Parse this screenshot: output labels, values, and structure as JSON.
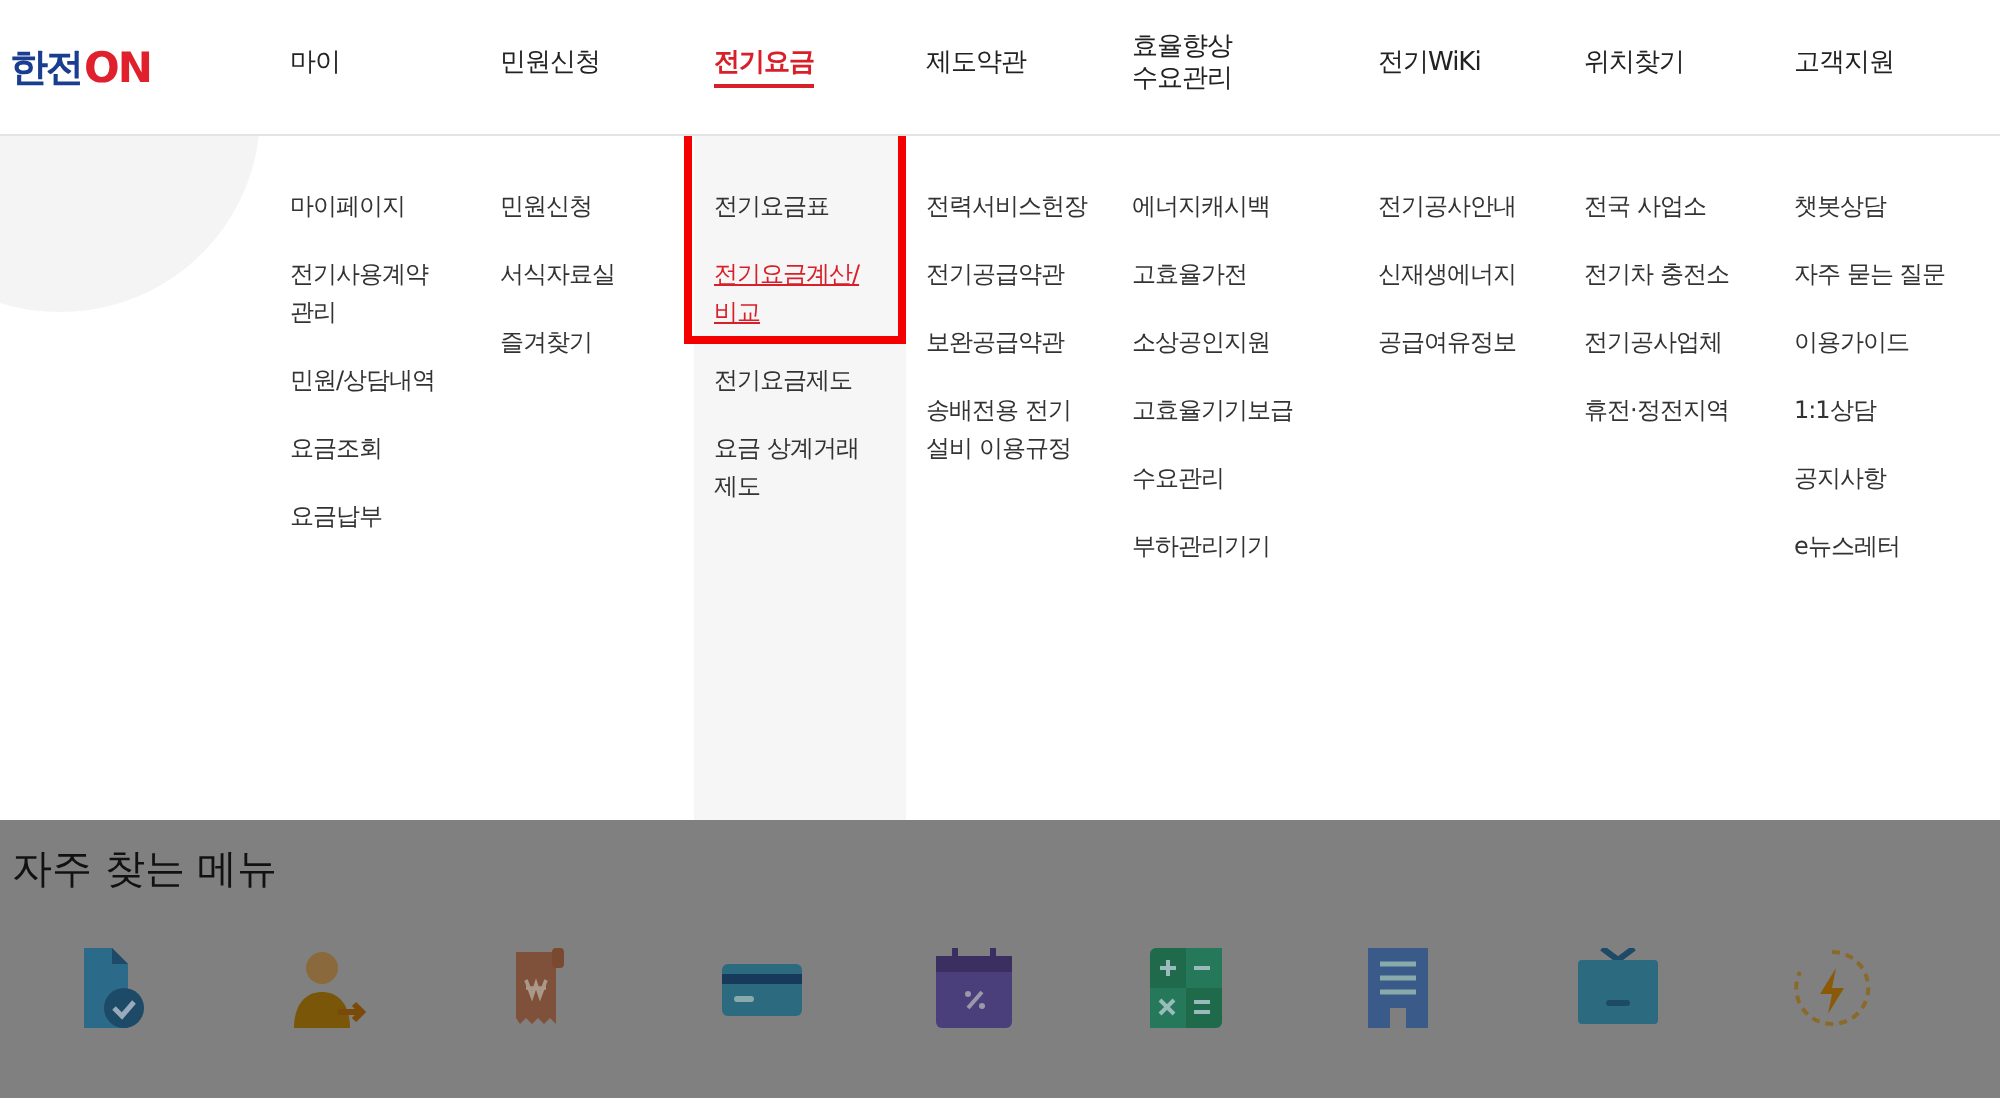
{
  "logo": {
    "text": "한전",
    "mark": "ON"
  },
  "nav": [
    {
      "label": "마이",
      "selected": false,
      "highlighted": false,
      "items": [
        {
          "label": "마이페이지",
          "selected": false
        },
        {
          "label": "전기사용계약 관리",
          "selected": false
        },
        {
          "label": "민원/상담내역",
          "selected": false
        },
        {
          "label": "요금조회",
          "selected": false
        },
        {
          "label": "요금납부",
          "selected": false
        }
      ]
    },
    {
      "label": "민원신청",
      "selected": false,
      "highlighted": false,
      "items": [
        {
          "label": "민원신청",
          "selected": false
        },
        {
          "label": "서식자료실",
          "selected": false
        },
        {
          "label": "즐겨찾기",
          "selected": false
        }
      ]
    },
    {
      "label": "전기요금",
      "selected": true,
      "highlighted": true,
      "items": [
        {
          "label": "전기요금표",
          "selected": false
        },
        {
          "label": "전기요금계산/ 비교",
          "selected": true
        },
        {
          "label": "전기요금제도",
          "selected": false
        },
        {
          "label": "요금 상계거래 제도",
          "selected": false
        }
      ]
    },
    {
      "label": "제도약관",
      "selected": false,
      "highlighted": false,
      "items": [
        {
          "label": "전력서비스헌장",
          "selected": false
        },
        {
          "label": "전기공급약관",
          "selected": false
        },
        {
          "label": "보완공급약관",
          "selected": false
        },
        {
          "label": "송배전용 전기 설비 이용규정",
          "selected": false
        }
      ]
    },
    {
      "label": "효율향상 수요관리",
      "selected": false,
      "highlighted": false,
      "items": [
        {
          "label": "에너지캐시백",
          "selected": false
        },
        {
          "label": "고효율가전",
          "selected": false
        },
        {
          "label": "소상공인지원",
          "selected": false
        },
        {
          "label": "고효율기기보급",
          "selected": false
        },
        {
          "label": "수요관리",
          "selected": false
        },
        {
          "label": "부하관리기기",
          "selected": false
        }
      ]
    },
    {
      "label": "전기WiKi",
      "selected": false,
      "highlighted": false,
      "items": [
        {
          "label": "전기공사안내",
          "selected": false
        },
        {
          "label": "신재생에너지",
          "selected": false
        },
        {
          "label": "공급여유정보",
          "selected": false
        }
      ]
    },
    {
      "label": "위치찾기",
      "selected": false,
      "highlighted": false,
      "items": [
        {
          "label": "전국 사업소",
          "selected": false
        },
        {
          "label": "전기차 충전소",
          "selected": false
        },
        {
          "label": "전기공사업체",
          "selected": false
        },
        {
          "label": "휴전·정전지역",
          "selected": false
        }
      ]
    },
    {
      "label": "고객지원",
      "selected": false,
      "highlighted": false,
      "items": [
        {
          "label": "챗봇상담",
          "selected": false
        },
        {
          "label": "자주 묻는 질문",
          "selected": false
        },
        {
          "label": "이용가이드",
          "selected": false
        },
        {
          "label": "1:1상담",
          "selected": false
        },
        {
          "label": "공지사항",
          "selected": false
        },
        {
          "label": "e뉴스레터",
          "selected": false
        }
      ]
    }
  ],
  "frequent_menu": {
    "title": "자주 찾는 메뉴"
  }
}
